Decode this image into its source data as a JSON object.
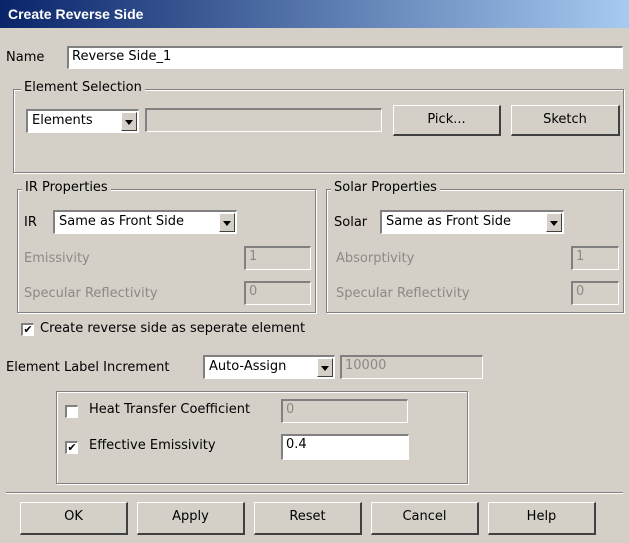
{
  "title": "Create Reverse Side",
  "name": {
    "label": "Name",
    "value": "Reverse Side_1"
  },
  "element_selection": {
    "title": "Element Selection",
    "type_value": "Elements",
    "entry_value": "",
    "pick_label": "Pick...",
    "sketch_label": "Sketch"
  },
  "ir": {
    "title": "IR Properties",
    "label": "IR",
    "value": "Same as Front Side",
    "emissivity_label": "Emissivity",
    "emissivity_value": "1",
    "specular_label": "Specular Reflectivity",
    "specular_value": "0"
  },
  "solar": {
    "title": "Solar Properties",
    "label": "Solar",
    "value": "Same as Front Side",
    "absorptivity_label": "Absorptivity",
    "absorptivity_value": "1",
    "specular_label": "Specular Reflectivity",
    "specular_value": "0"
  },
  "separate_element": {
    "label": "Create reverse side as seperate element",
    "checked": true
  },
  "label_increment": {
    "label": "Element Label Increment",
    "mode": "Auto-Assign",
    "value": "10000"
  },
  "heat_transfer": {
    "label": "Heat Transfer Coefficient",
    "checked": false,
    "value": "0"
  },
  "effective_emissivity": {
    "label": "Effective Emissivity",
    "checked": true,
    "value": "0.4"
  },
  "buttons": {
    "ok": "OK",
    "apply": "Apply",
    "reset": "Reset",
    "cancel": "Cancel",
    "help": "Help"
  }
}
